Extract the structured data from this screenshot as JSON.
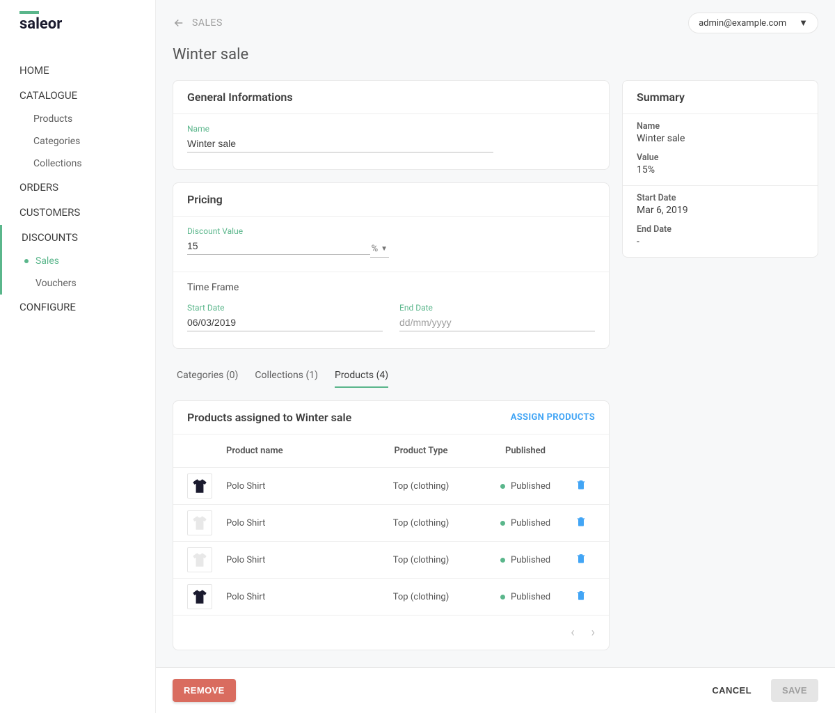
{
  "logo": "saleor",
  "nav": {
    "home": "HOME",
    "catalogue": "CATALOGUE",
    "products": "Products",
    "categories": "Categories",
    "collections": "Collections",
    "orders": "ORDERS",
    "customers": "CUSTOMERS",
    "discounts": "DISCOUNTS",
    "sales": "Sales",
    "vouchers": "Vouchers",
    "configure": "CONFIGURE"
  },
  "breadcrumb": "SALES",
  "user_email": "admin@example.com",
  "page_title": "Winter sale",
  "general": {
    "heading": "General Informations",
    "name_label": "Name",
    "name_value": "Winter sale"
  },
  "pricing": {
    "heading": "Pricing",
    "discount_label": "Discount Value",
    "discount_value": "15",
    "unit": "%",
    "timeframe_heading": "Time Frame",
    "start_label": "Start Date",
    "start_value": "06/03/2019",
    "end_label": "End Date",
    "end_placeholder": "dd/mm/yyyy"
  },
  "tabs": {
    "categories": "Categories (0)",
    "collections": "Collections (1)",
    "products": "Products (4)"
  },
  "table": {
    "title": "Products assigned to Winter sale",
    "assign": "ASSIGN PRODUCTS",
    "cols": {
      "name": "Product name",
      "type": "Product Type",
      "published": "Published"
    },
    "rows": [
      {
        "name": "Polo Shirt",
        "type": "Top (clothing)",
        "published": "Published",
        "color": "#1a1a2e"
      },
      {
        "name": "Polo Shirt",
        "type": "Top (clothing)",
        "published": "Published",
        "color": "#e8e8e8"
      },
      {
        "name": "Polo Shirt",
        "type": "Top (clothing)",
        "published": "Published",
        "color": "#e8e8e8"
      },
      {
        "name": "Polo Shirt",
        "type": "Top (clothing)",
        "published": "Published",
        "color": "#1a1a2e"
      }
    ]
  },
  "summary": {
    "heading": "Summary",
    "name_label": "Name",
    "name_value": "Winter sale",
    "value_label": "Value",
    "value_value": "15%",
    "start_label": "Start Date",
    "start_value": "Mar 6, 2019",
    "end_label": "End Date",
    "end_value": "-"
  },
  "footer": {
    "remove": "REMOVE",
    "cancel": "CANCEL",
    "save": "SAVE"
  }
}
